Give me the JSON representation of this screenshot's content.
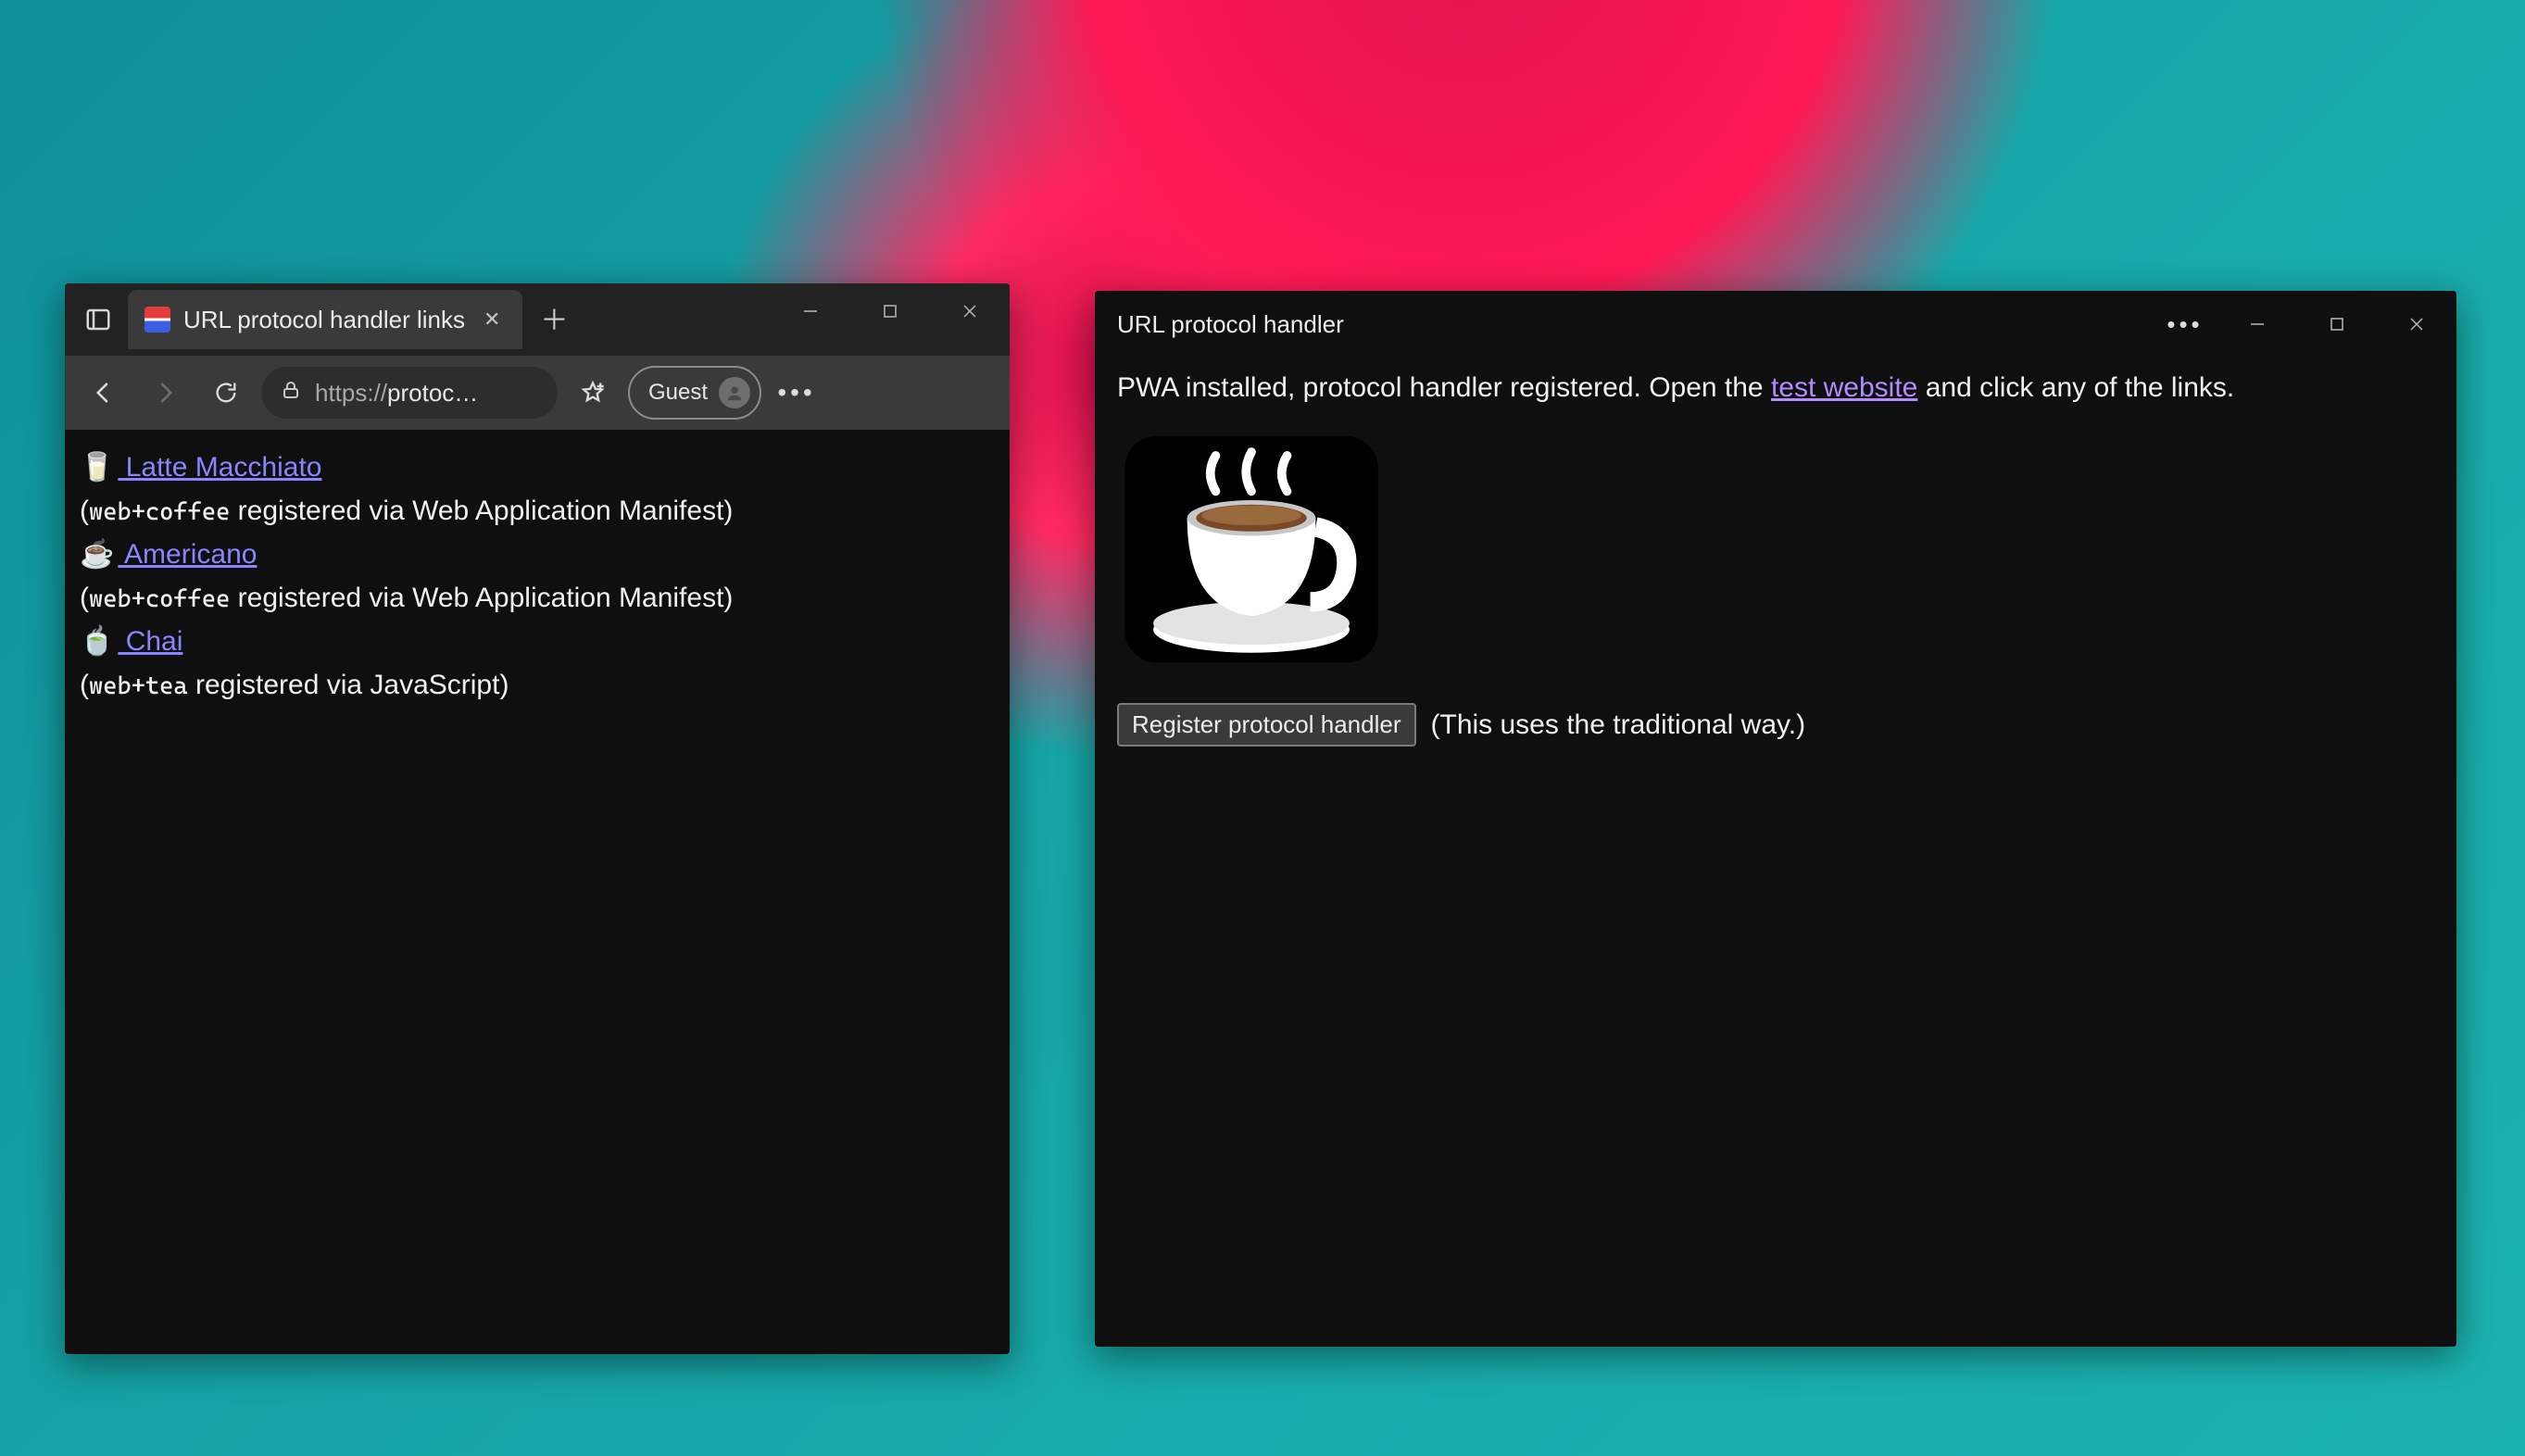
{
  "browser": {
    "tab": {
      "title": "URL protocol handler links"
    },
    "address_url_prefix": "https://",
    "address_url_rest": "protoc…",
    "profile_label": "Guest",
    "content": {
      "link1_emoji": "🥛",
      "link1_text": "  Latte Macchiato",
      "line1_open": "(",
      "line1_code": "web+coffee",
      "line1_rest": " registered via Web Application Manifest)",
      "link2_emoji": "☕",
      "link2_text": "  Americano",
      "line2_open": "(",
      "line2_code": "web+coffee",
      "line2_rest": " registered via Web Application Manifest)",
      "link3_emoji": "🍵",
      "link3_text": "  Chai",
      "line3_open": "(",
      "line3_code": "web+tea",
      "line3_rest": " registered via JavaScript)"
    }
  },
  "pwa": {
    "title": "URL protocol handler",
    "text_before_link": "PWA installed, protocol handler registered. Open the ",
    "link_text": "test website",
    "text_after_link": " and click any of the links.",
    "button_label": "Register protocol handler",
    "button_aside": "(This uses the traditional way.)"
  }
}
